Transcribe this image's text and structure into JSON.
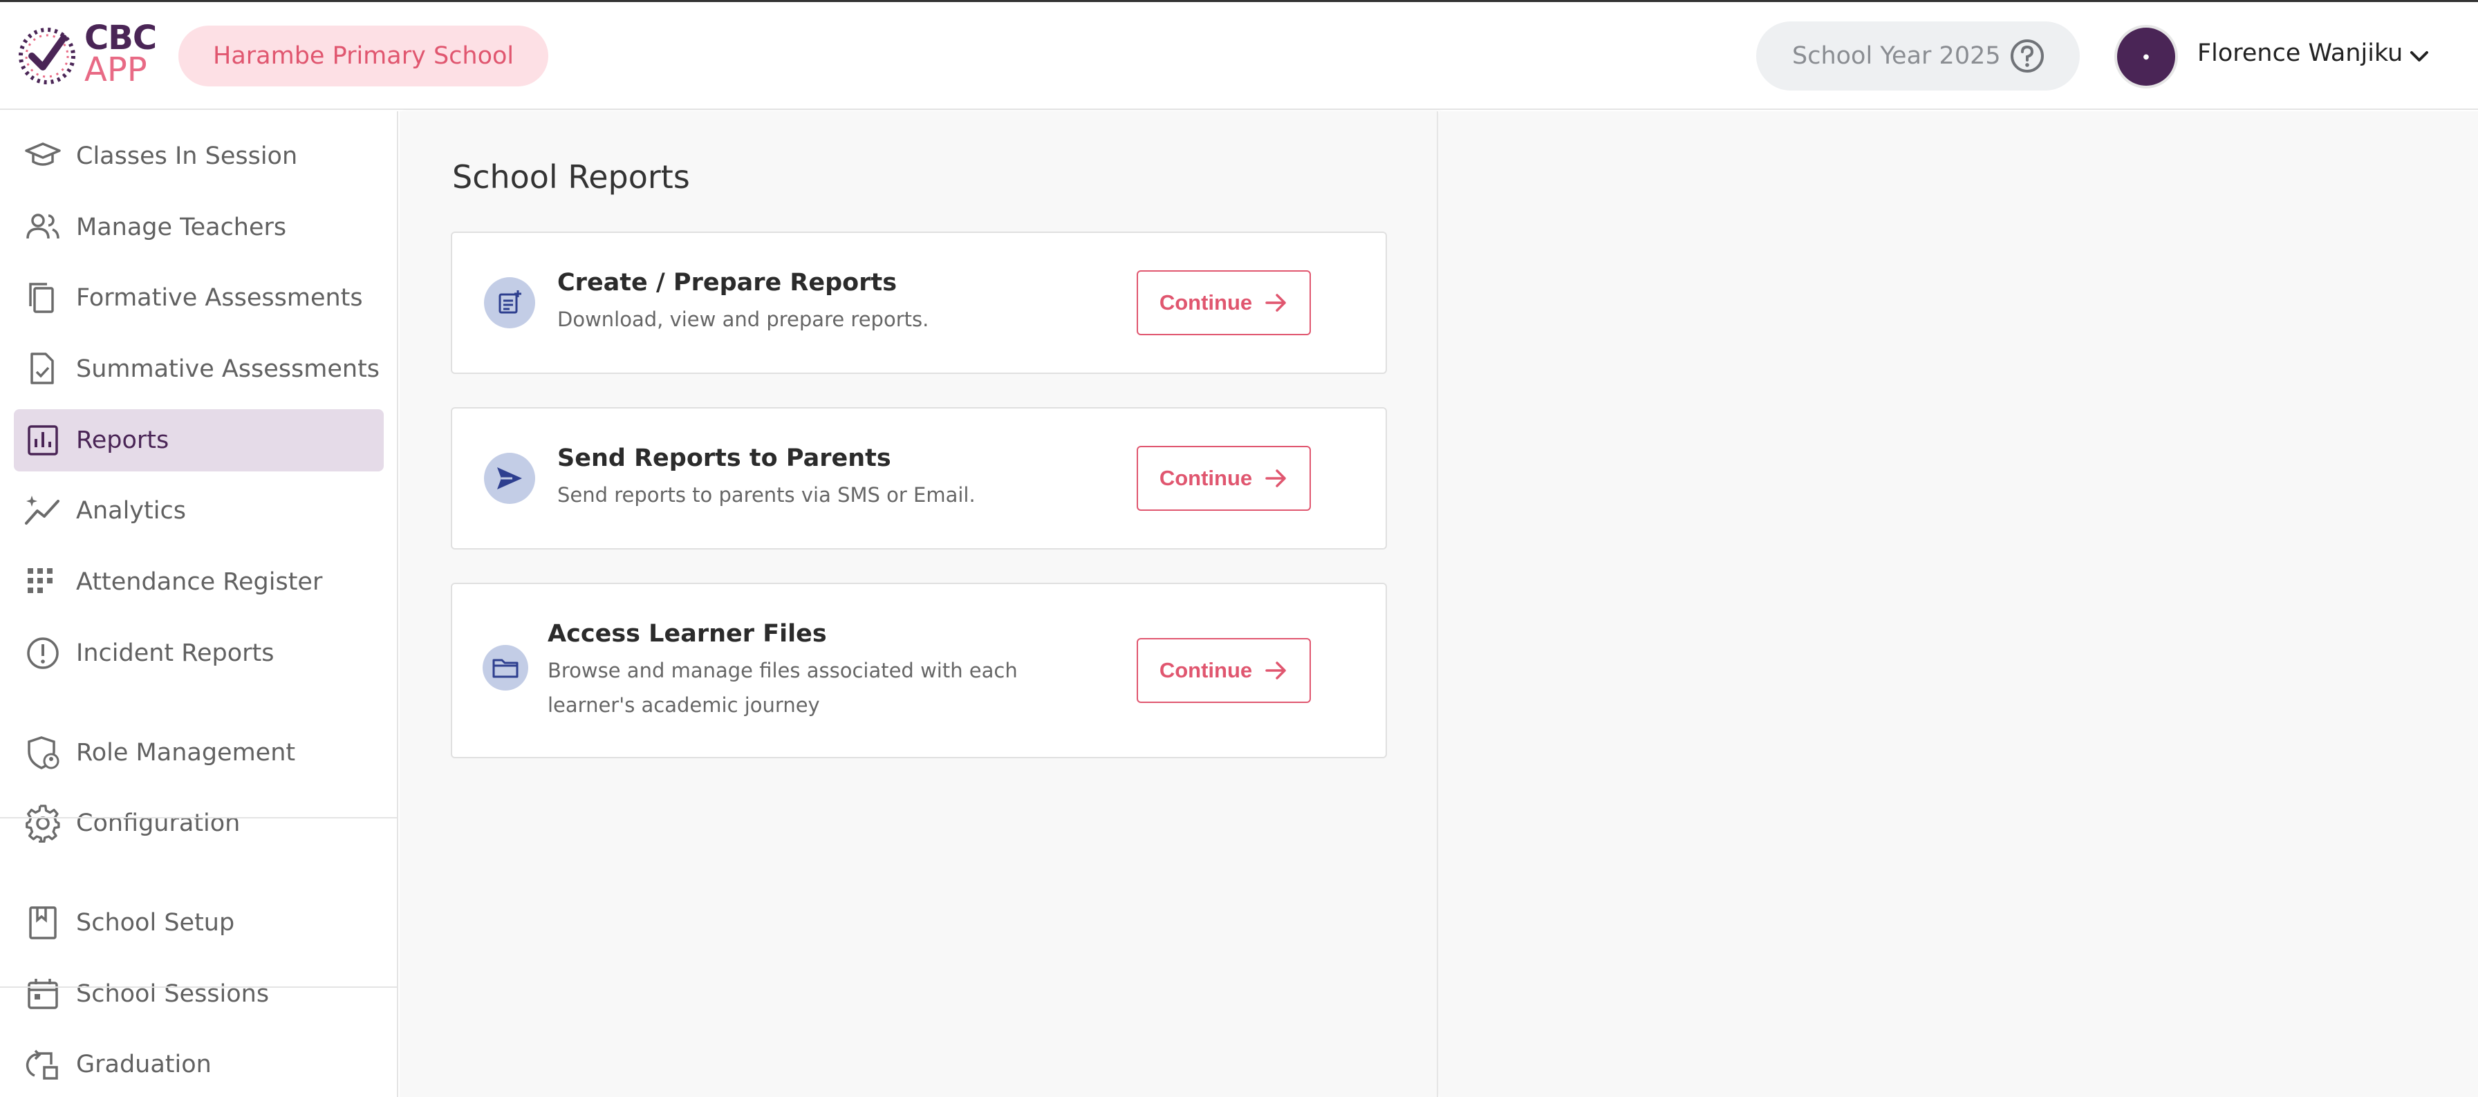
{
  "app": {
    "logo_top": "CBC",
    "logo_bottom": "APP",
    "brand_primary": "#4a2556",
    "brand_accent": "#e0566f"
  },
  "header": {
    "school_name": "Harambe Primary School",
    "school_year": "School Year 2025",
    "user_name": "Florence Wanjiku"
  },
  "sidebar": {
    "items": [
      {
        "label": "Classes In Session",
        "icon": "graduation-cap-icon"
      },
      {
        "label": "Manage Teachers",
        "icon": "people-icon"
      },
      {
        "label": "Formative Assessments",
        "icon": "copy-files-icon"
      },
      {
        "label": "Summative Assessments",
        "icon": "document-check-icon"
      },
      {
        "label": "Reports",
        "icon": "bar-chart-icon",
        "active": true
      },
      {
        "label": "Analytics",
        "icon": "trend-line-icon"
      },
      {
        "label": "Attendance Register",
        "icon": "grid-dots-icon"
      },
      {
        "label": "Incident Reports",
        "icon": "alert-circle-icon"
      },
      {
        "label": "Role Management",
        "icon": "shield-user-icon"
      },
      {
        "label": "Configuration",
        "icon": "gear-icon"
      },
      {
        "label": "School Setup",
        "icon": "bookmark-book-icon"
      },
      {
        "label": "School Sessions",
        "icon": "calendar-icon"
      },
      {
        "label": "Graduation",
        "icon": "swap-icon"
      }
    ]
  },
  "main": {
    "title": "School Reports",
    "cards": [
      {
        "title": "Create / Prepare Reports",
        "description": "Download, view and prepare reports.",
        "button": "Continue",
        "icon": "add-note-icon"
      },
      {
        "title": "Send Reports to Parents",
        "description": "Send reports to parents via SMS or Email.",
        "button": "Continue",
        "icon": "send-icon"
      },
      {
        "title": "Access Learner Files",
        "description": "Browse and manage files associated with each learner's academic journey",
        "button": "Continue",
        "icon": "folder-icon"
      }
    ]
  }
}
